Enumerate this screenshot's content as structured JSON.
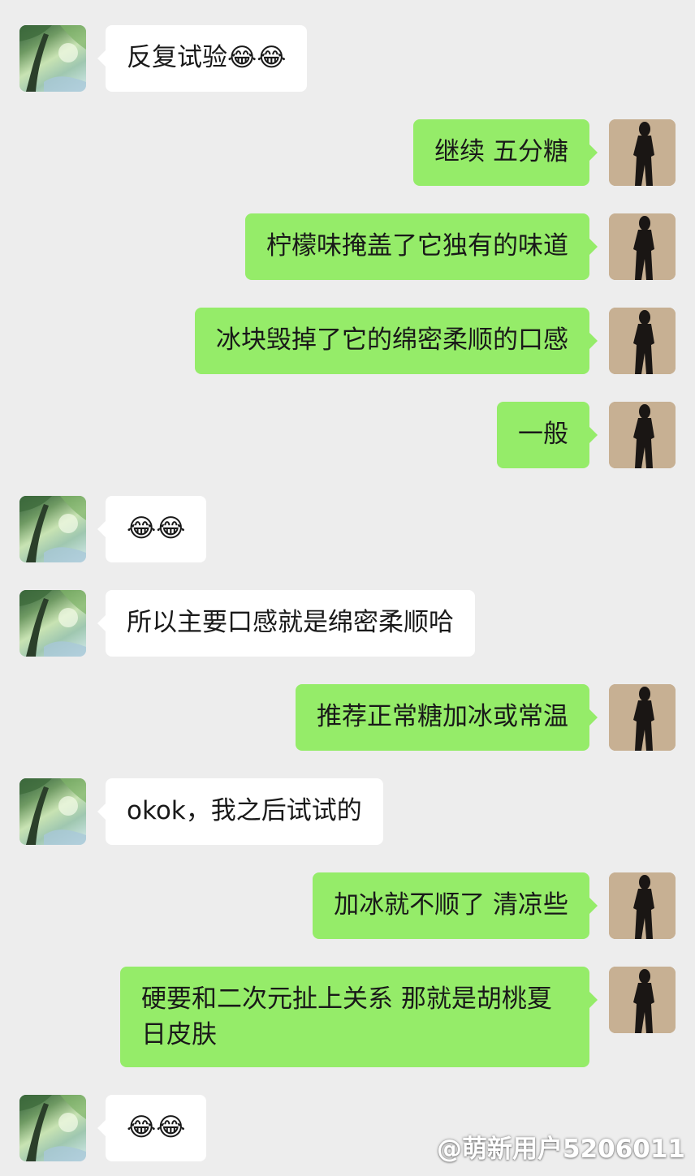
{
  "messages": [
    {
      "side": "left",
      "text": "反复试验😂😂"
    },
    {
      "side": "right",
      "text": "继续 五分糖"
    },
    {
      "side": "right",
      "text": "柠檬味掩盖了它独有的味道"
    },
    {
      "side": "right",
      "text": "冰块毁掉了它的绵密柔顺的口感"
    },
    {
      "side": "right",
      "text": "一般"
    },
    {
      "side": "left",
      "text": "😂😂"
    },
    {
      "side": "left",
      "text": "所以主要口感就是绵密柔顺哈"
    },
    {
      "side": "right",
      "text": "推荐正常糖加冰或常温"
    },
    {
      "side": "left",
      "text": "okok，我之后试试的"
    },
    {
      "side": "right",
      "text": "加冰就不顺了 清凉些"
    },
    {
      "side": "right",
      "text": "硬要和二次元扯上关系 那就是胡桃夏日皮肤"
    },
    {
      "side": "left",
      "text": "😂😂"
    }
  ],
  "avatars": {
    "left": "forest-anime-avatar",
    "right": "shadow-silhouette-avatar"
  },
  "colors": {
    "background": "#ededed",
    "left_bubble": "#ffffff",
    "right_bubble": "#95ec69",
    "text": "#191919"
  },
  "watermark": {
    "text": "@萌新用户5206011"
  }
}
